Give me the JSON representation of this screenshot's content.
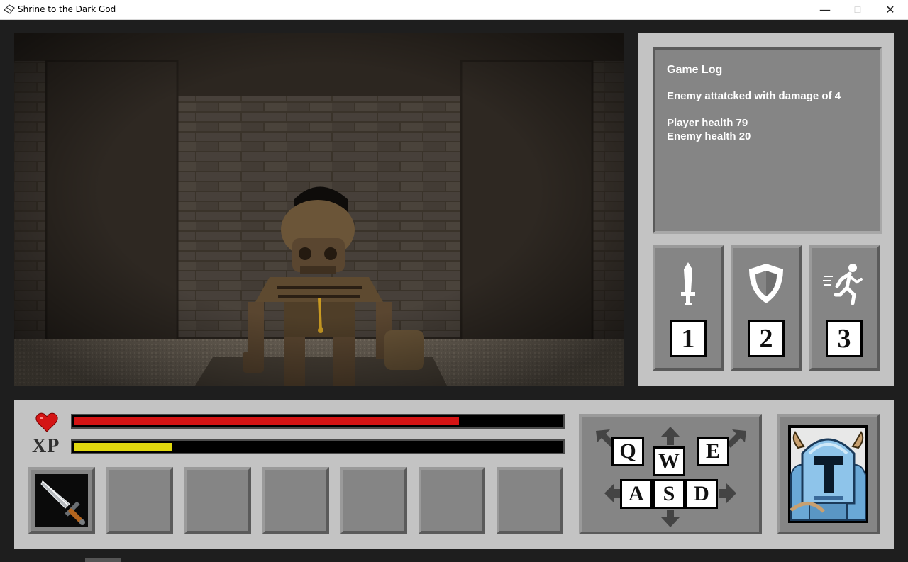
{
  "window": {
    "title": "Shrine to the Dark God",
    "minimize_glyph": "—",
    "maximize_glyph": "☐",
    "close_glyph": "✕"
  },
  "game_log": {
    "title": "Game Log",
    "lines": [
      "Enemy attatcked with damage of 4",
      "Player health 79",
      "Enemy health 20"
    ]
  },
  "actions": [
    {
      "key": "1",
      "icon": "sword-icon"
    },
    {
      "key": "2",
      "icon": "shield-icon"
    },
    {
      "key": "3",
      "icon": "flee-icon"
    }
  ],
  "status": {
    "health_icon": "heart-icon",
    "health_fraction": 0.79,
    "health_color": "#d41414",
    "xp_label": "XP",
    "xp_fraction": 0.2,
    "xp_color": "#e0d80e"
  },
  "inventory": {
    "slots": [
      "sword-item-icon",
      "",
      "",
      "",
      "",
      "",
      ""
    ]
  },
  "movement_keys": {
    "q": "Q",
    "w": "W",
    "e": "E",
    "a": "A",
    "s": "S",
    "d": "D"
  },
  "portrait": "knight-portrait-icon",
  "colors": {
    "panel": "#c3c3c3",
    "button": "#858585",
    "log_text": "#ffffff"
  }
}
